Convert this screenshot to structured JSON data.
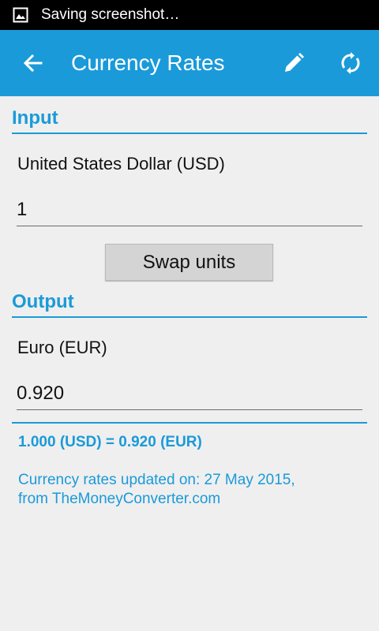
{
  "status_bar": {
    "notification_text": "Saving screenshot…",
    "icon": "image-icon"
  },
  "app_bar": {
    "title": "Currency Rates",
    "background": "#1a9ad9",
    "icons": [
      "back-arrow-icon",
      "pencil-icon",
      "refresh-icon"
    ]
  },
  "input": {
    "header": "Input",
    "currency_label": "United States Dollar  (USD)",
    "value": "1"
  },
  "swap_label": "Swap units",
  "output": {
    "header": "Output",
    "currency_label": "Euro  (EUR)",
    "value": "0.920"
  },
  "conversion_text": "1.000  (USD) = 0.920  (EUR)",
  "info": {
    "line1": "Currency rates updated on: 27 May 2015,",
    "line2": "from TheMoneyConverter.com"
  }
}
